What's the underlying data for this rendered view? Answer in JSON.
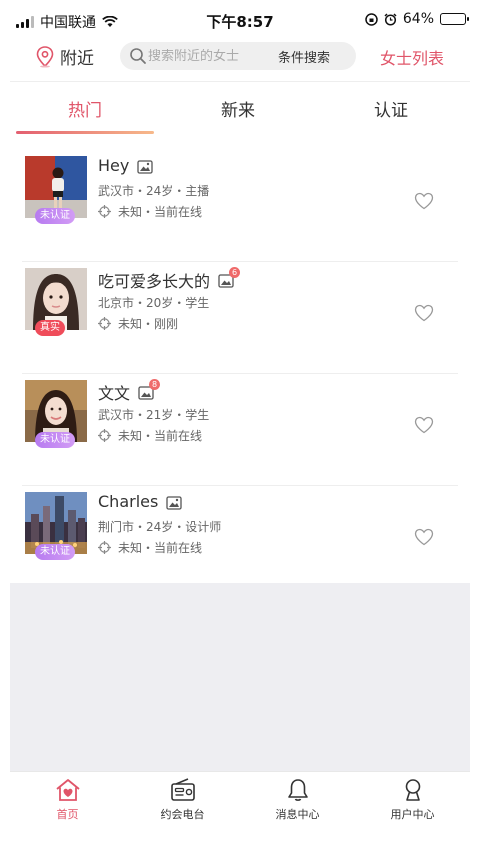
{
  "status_bar": {
    "carrier": "中国联通",
    "time": "下午8:57",
    "battery": "64%",
    "battery_level": 0.64
  },
  "header": {
    "nearby_label": "附近",
    "search_placeholder": "搜索附近的女士",
    "condition_search_label": "条件搜索",
    "ladies_list_label": "女士列表"
  },
  "tabs": [
    {
      "label": "热门",
      "active": true
    },
    {
      "label": "新来",
      "active": false
    },
    {
      "label": "认证",
      "active": false
    }
  ],
  "users": [
    {
      "name": "Hey",
      "meta": "武汉市・24岁・主播",
      "location": "未知・当前在线",
      "badge": "未认证",
      "badge_type": "unverified",
      "photo_count": ""
    },
    {
      "name": "吃可爱多长大的",
      "meta": "北京市・20岁・学生",
      "location": "未知・刚刚",
      "badge": "真实",
      "badge_type": "real",
      "photo_count": "6"
    },
    {
      "name": "文文",
      "meta": "武汉市・21岁・学生",
      "location": "未知・当前在线",
      "badge": "未认证",
      "badge_type": "unverified",
      "photo_count": "8"
    },
    {
      "name": "Charles",
      "meta": "荆门市・24岁・设计师",
      "location": "未知・当前在线",
      "badge": "未认证",
      "badge_type": "unverified",
      "photo_count": ""
    }
  ],
  "bottom_nav": [
    {
      "label": "首页",
      "icon": "home-heart-icon",
      "active": true
    },
    {
      "label": "约会电台",
      "icon": "radio-icon",
      "active": false
    },
    {
      "label": "消息中心",
      "icon": "bell-icon",
      "active": false
    },
    {
      "label": "用户中心",
      "icon": "user-icon",
      "active": false
    }
  ],
  "colors": {
    "accent": "#e05569",
    "unverified_badge": "#c08af2",
    "real_badge": "#ef4c5a"
  }
}
